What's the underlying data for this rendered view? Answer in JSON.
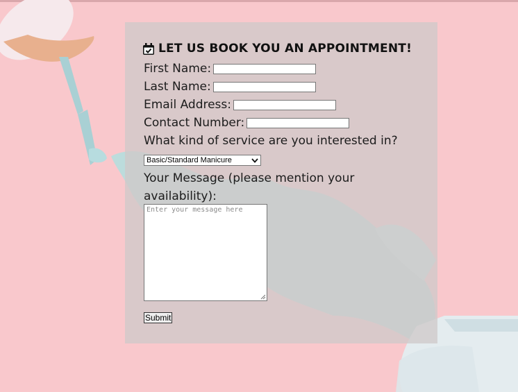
{
  "form": {
    "title": "LET US BOOK YOU AN APPOINTMENT!",
    "first_name_label": "First Name:",
    "last_name_label": "Last Name:",
    "email_label": "Email Address:",
    "contact_label": "Contact Number:",
    "service_question": "What kind of service are you interested in?",
    "service_selected": "Basic/Standard Manicure",
    "message_label": "Your Message (please mention your availability):",
    "message_placeholder": "Enter your message here",
    "submit_label": "Submit"
  },
  "icons": {
    "title_icon": "calendar-check-icon",
    "select_arrow": "chevron-down-icon"
  }
}
